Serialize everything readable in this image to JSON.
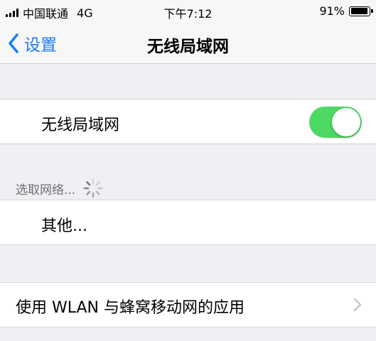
{
  "status_bar": {
    "carrier": "中国联通",
    "network": "4G",
    "time": "下午7:12",
    "battery_percent": "91%",
    "battery_level": 0.91,
    "signal_bars": 4
  },
  "nav": {
    "back_label": "设置",
    "title": "无线局域网"
  },
  "wifi": {
    "label": "无线局域网",
    "enabled": true,
    "toggle_color": "#4cd964"
  },
  "networks_section": {
    "header": "选取网络...",
    "other_label": "其他..."
  },
  "wlan_apps": {
    "label": "使用 WLAN 与蜂窝移动网的应用"
  },
  "colors": {
    "accent": "#1a7cf5",
    "background": "#efeff4",
    "secondary_text": "#6d6d72"
  }
}
